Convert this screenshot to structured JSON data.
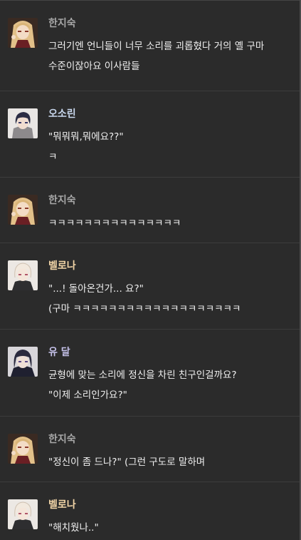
{
  "messages": [
    {
      "name": "한지숙",
      "name_color": "#a8a8a8",
      "avatar": "avatar-blonde",
      "lines": [
        "그러기엔 언니들이 너무 소리를 괴롭혔다 거의 옐 구마",
        "수준이잖아요 이사람들"
      ]
    },
    {
      "name": "오소린",
      "name_color": "#c9d8ee",
      "avatar": "avatar-dark-hair-hoodie",
      "lines": [
        "\"뭐뭐뭐,뭐에요??\"",
        "ㅋ"
      ]
    },
    {
      "name": "한지숙",
      "name_color": "#a8a8a8",
      "avatar": "avatar-blonde",
      "lines": [
        "ㅋㅋㅋㅋㅋㅋㅋㅋㅋㅋㅋㅋㅋㅋㅋ"
      ]
    },
    {
      "name": "벨로나",
      "name_color": "#f3d6a8",
      "avatar": "avatar-white-hair",
      "lines": [
        "\"...! 돌아온건가... 요?\"",
        "(구마 ㅋㅋㅋㅋㅋㅋㅋㅋㅋㅋㅋㅋㅋㅋㅋㅋㅋㅋㅋ"
      ]
    },
    {
      "name": "유 달",
      "name_color": "#c4c0e8",
      "avatar": "avatar-dark-hair",
      "lines": [
        "균형에 맞는 소리에 정신을 차린 친구인걸까요?",
        "\"이제 소리인가요?\""
      ]
    },
    {
      "name": "한지숙",
      "name_color": "#a8a8a8",
      "avatar": "avatar-blonde",
      "lines": [
        "\"정신이 좀 드나?\" (그런 구도로 말하며"
      ]
    },
    {
      "name": "벨로나",
      "name_color": "#f3d6a8",
      "avatar": "avatar-white-hair",
      "lines": [
        "\"해치웠나..\""
      ]
    }
  ]
}
